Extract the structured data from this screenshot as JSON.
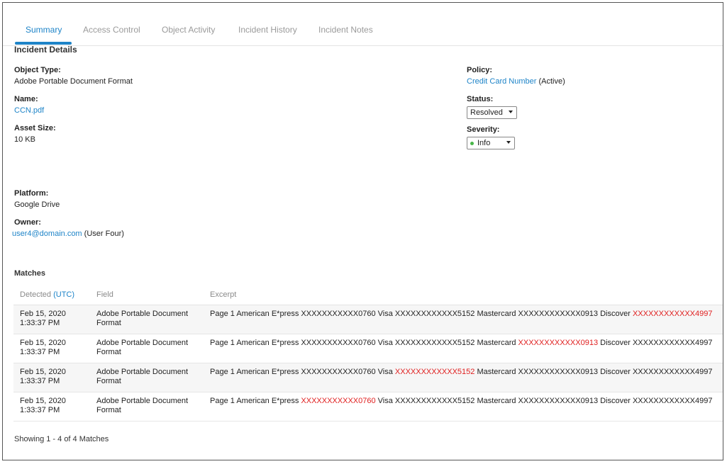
{
  "tabs": [
    {
      "label": "Summary",
      "active": true
    },
    {
      "label": "Access Control",
      "active": false
    },
    {
      "label": "Object Activity",
      "active": false
    },
    {
      "label": "Incident History",
      "active": false
    },
    {
      "label": "Incident Notes",
      "active": false
    }
  ],
  "details": {
    "title": "Incident Details",
    "object_type_label": "Object Type:",
    "object_type_value": "Adobe Portable Document Format",
    "name_label": "Name:",
    "name_value": "CCN.pdf",
    "asset_size_label": "Asset Size:",
    "asset_size_value": "10 KB",
    "platform_label": "Platform:",
    "platform_value": "Google Drive",
    "owner_label": "Owner:",
    "owner_email": "user4@domain.com",
    "owner_name": "(User Four)",
    "policy_label": "Policy:",
    "policy_value": "Credit Card Number",
    "policy_state": "(Active)",
    "status_label": "Status:",
    "status_value": "Resolved",
    "severity_label": "Severity:",
    "severity_value": "Info"
  },
  "matches": {
    "title": "Matches",
    "headers": {
      "detected": "Detected",
      "utc": "(UTC)",
      "field": "Field",
      "excerpt": "Excerpt"
    },
    "rows": [
      {
        "date": "Feb 15, 2020",
        "time": "1:33:37 PM",
        "field": "Adobe Portable Document Format",
        "excerpt": [
          {
            "text": "Page 1 American E*press XXXXXXXXXXX0760 Visa XXXXXXXXXXXX5152 Mastercard XXXXXXXXXXXX0913 Discover ",
            "hl": false
          },
          {
            "text": "XXXXXXXXXXXX4997",
            "hl": true
          }
        ]
      },
      {
        "date": "Feb 15, 2020",
        "time": "1:33:37 PM",
        "field": "Adobe Portable Document Format",
        "excerpt": [
          {
            "text": "Page 1 American E*press XXXXXXXXXXX0760 Visa XXXXXXXXXXXX5152 Mastercard ",
            "hl": false
          },
          {
            "text": "XXXXXXXXXXXX0913",
            "hl": true
          },
          {
            "text": " Discover XXXXXXXXXXXX4997",
            "hl": false
          }
        ]
      },
      {
        "date": "Feb 15, 2020",
        "time": "1:33:37 PM",
        "field": "Adobe Portable Document Format",
        "excerpt": [
          {
            "text": "Page 1 American E*press XXXXXXXXXXX0760 Visa ",
            "hl": false
          },
          {
            "text": "XXXXXXXXXXXX5152",
            "hl": true
          },
          {
            "text": " Mastercard XXXXXXXXXXXX0913 Discover XXXXXXXXXXXX4997",
            "hl": false
          }
        ]
      },
      {
        "date": "Feb 15, 2020",
        "time": "1:33:37 PM",
        "field": "Adobe Portable Document Format",
        "excerpt": [
          {
            "text": "Page 1 American E*press ",
            "hl": false
          },
          {
            "text": "XXXXXXXXXXX0760",
            "hl": true
          },
          {
            "text": " Visa XXXXXXXXXXXX5152 Mastercard XXXXXXXXXXXX0913 Discover XXXXXXXXXXXX4997",
            "hl": false
          }
        ]
      }
    ],
    "footer": "Showing 1 - 4 of 4 Matches"
  },
  "colors": {
    "accent": "#1e84c8",
    "highlight": "#e02020",
    "severity_dot": "#49b649"
  }
}
